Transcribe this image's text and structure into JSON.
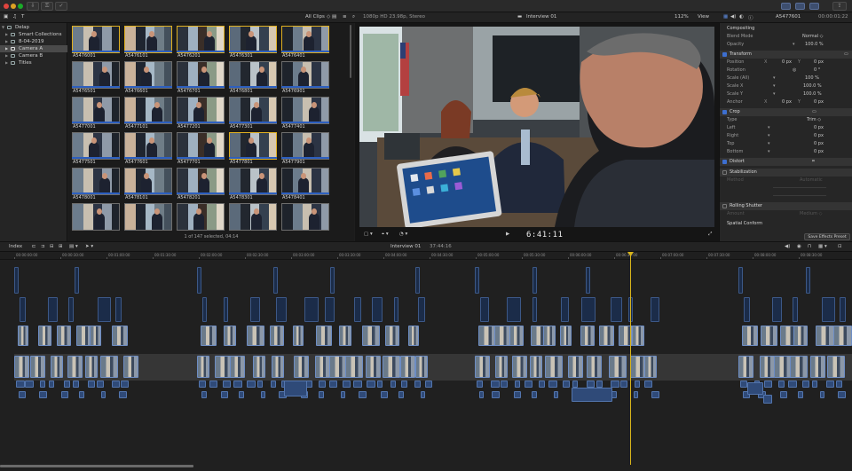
{
  "toolbar": {
    "clip_filter": "All Clips",
    "format_info": "1080p HD 23.98p, Stereo",
    "project_name": "Interview 01",
    "zoom": "112%",
    "view_menu": "View",
    "inspector_clip": "A5477601",
    "inspector_duration": "00:00:01:22"
  },
  "sidebar": {
    "library": "Delap",
    "items": [
      {
        "label": "Smart Collections"
      },
      {
        "label": "8-04-2019"
      },
      {
        "label": "Camera A"
      },
      {
        "label": "Camera B"
      },
      {
        "label": "Titles"
      }
    ]
  },
  "browser": {
    "clips": [
      "A5476001",
      "A5476101",
      "A5476201",
      "A5476301",
      "A5476401",
      "A5476501",
      "A5476601",
      "A5476701",
      "A5476801",
      "A5476901",
      "A5477001",
      "A5477101",
      "A5477201",
      "A5477301",
      "A5477401",
      "A5477501",
      "A5477601",
      "A5477701",
      "A5477801",
      "A5477901",
      "A5478001",
      "A5478101",
      "A5478201",
      "A5478301",
      "A5478401",
      "",
      "",
      "",
      "",
      ""
    ],
    "footer": "1 of 147 selected, 04:14"
  },
  "viewer": {
    "timecode": "6:41:11"
  },
  "inspector": {
    "sections": {
      "compositing": "Compositing",
      "blend_mode_label": "Blend Mode",
      "blend_mode_value": "Normal ◇",
      "opacity_label": "Opacity",
      "opacity_value": "100.0  %",
      "transform": "Transform",
      "position_label": "Position",
      "position_x_axis": "X",
      "position_x": "0  px",
      "position_y_axis": "Y",
      "position_y": "0  px",
      "rotation_label": "Rotation",
      "rotation_value": "0  °",
      "scale_all_label": "Scale (All)",
      "scale_all_value": "100  %",
      "scale_x_label": "Scale X",
      "scale_x_value": "100.0  %",
      "scale_y_label": "Scale Y",
      "scale_y_value": "100.0  %",
      "anchor_label": "Anchor",
      "anchor_x_axis": "X",
      "anchor_x": "0  px",
      "anchor_y_axis": "Y",
      "anchor_y": "0  px",
      "crop": "Crop",
      "crop_type_label": "Type",
      "crop_type_value": "Trim ◇",
      "crop_left": "Left",
      "crop_left_value": "0  px",
      "crop_right": "Right",
      "crop_right_value": "0  px",
      "crop_top": "Top",
      "crop_top_value": "0  px",
      "crop_bottom": "Bottom",
      "crop_bottom_value": "0  px",
      "distort": "Distort",
      "stabilization": "Stabilization",
      "stab_method": "Method",
      "stab_method_value": "Automatic",
      "rolling_shutter": "Rolling Shutter",
      "rs_amount": "Amount",
      "rs_amount_value": "Medium ◇",
      "spatial_conform": "Spatial Conform"
    },
    "save_preset": "Save Effects Preset"
  },
  "timeline": {
    "index_label": "Index",
    "project_name": "Interview 01",
    "duration": "37:44:16",
    "ruler": [
      "00:00:00:00",
      "00:00:30:00",
      "00:01:00:00",
      "00:01:30:00",
      "00:02:00:00",
      "00:02:30:00",
      "00:03:00:00",
      "00:03:30:00",
      "00:04:00:00",
      "00:04:30:00",
      "00:05:00:00",
      "00:05:30:00",
      "00:06:00:00",
      "00:06:30:00",
      "00:07:00:00",
      "00:07:30:00",
      "00:08:00:00",
      "00:08:30:00"
    ]
  },
  "colors": {
    "accent": "#d8b41b",
    "clip_blue": "#2f4a78",
    "selection_gold": "#b08a1c",
    "check_blue": "#3d6fd0"
  }
}
